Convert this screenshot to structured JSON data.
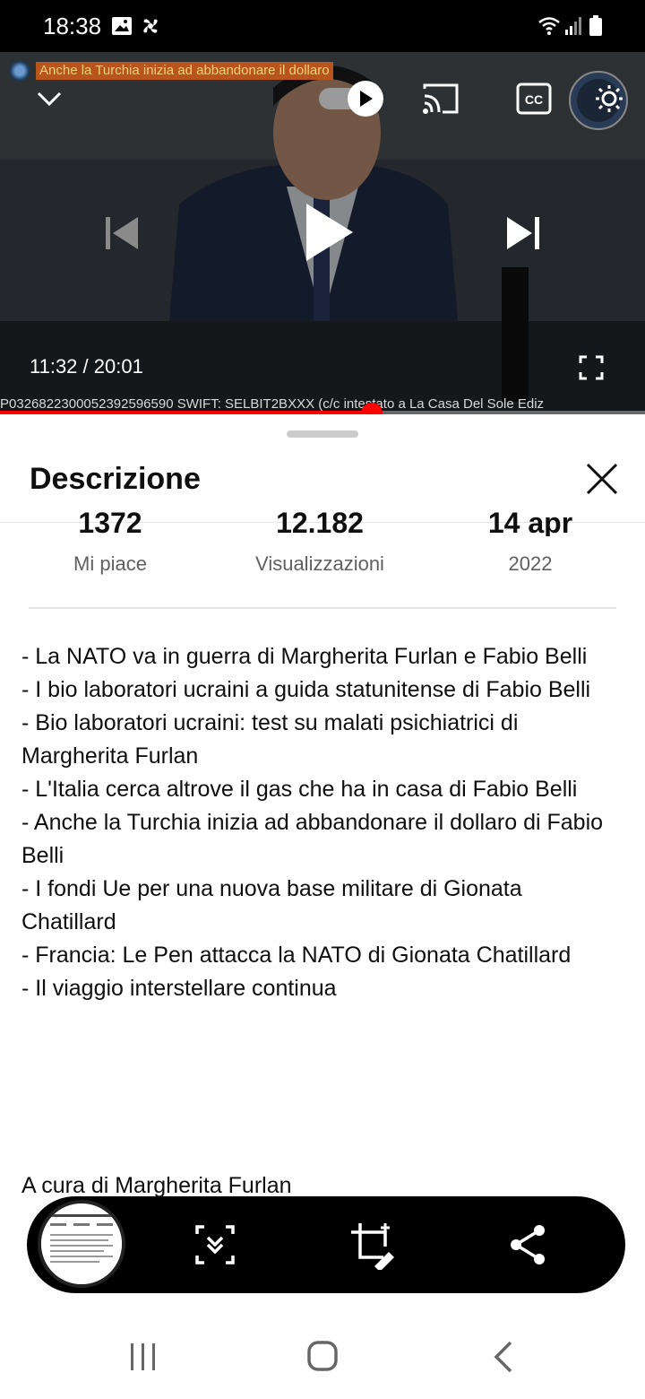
{
  "status_bar": {
    "time": "18:38"
  },
  "video": {
    "overlay_title": "Anche la Turchia inizia ad abbandonare il dollaro",
    "ticker": "P0326822300052392596590   SWIFT: SELBIT2BXXX   (c/c intestato a La Casa Del Sole Ediz",
    "time": "11:32 / 20:01",
    "progress": 0.5758
  },
  "sheet": {
    "title": "Descrizione",
    "stats": [
      {
        "value": "1372",
        "label": "Mi piace"
      },
      {
        "value": "12.182",
        "label": "Visualizzazioni"
      },
      {
        "value": "14 apr",
        "label": "2022"
      }
    ],
    "description_lines": [
      "- La NATO va in guerra  di Margherita Furlan e Fabio Belli",
      "- I bio laboratori ucraini a guida statunitense  di Fabio Belli",
      "- Bio laboratori ucraini: test su malati psichiatrici  di Margherita Furlan",
      "- L'Italia cerca altrove il gas che ha in casa  di Fabio Belli",
      "- Anche la Turchia inizia ad abbandonare il dollaro  di Fabio Belli",
      "- I fondi Ue per una nuova base militare  di Gionata Chatillard",
      "- Francia: Le Pen attacca la NATO  di Gionata Chatillard",
      "- Il viaggio interstellare continua"
    ],
    "credits": "A cura di Margherita Furlan"
  },
  "colors": {
    "accent": "#ff0000",
    "toolbar": "#000000"
  }
}
